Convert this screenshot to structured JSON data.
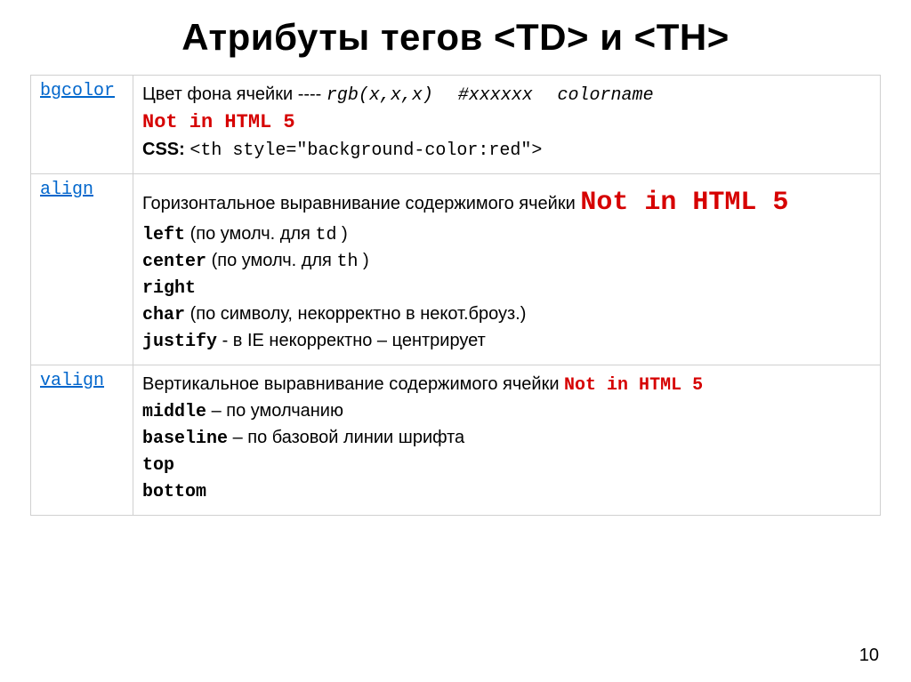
{
  "title": "Атрибуты тегов <TD> и <TH>",
  "pageNumber": "10",
  "rows": {
    "bgcolor": {
      "name": "bgcolor",
      "line1_a": "Цвет фона ячейки ---- ",
      "line1_rgb": "rgb(x,x,x)",
      "line1_hex": "#xxxxxx",
      "line1_cname": "colorname",
      "notIn": "Not in HTML 5",
      "cssLabel": "CSS:",
      "cssCode": "<th style=\"background-color:red\">"
    },
    "align": {
      "name": "align",
      "line1": "Горизонтальное выравнивание содержимого ячейки ",
      "notIn": "Not in HTML 5",
      "left_code": "left",
      "left_txt": " (по умолч. для ",
      "left_tag": "td",
      "left_close": ")",
      "center_code": "center",
      "center_txt": " (по умолч. для ",
      "center_tag": "th",
      "center_close": ")",
      "right_code": "right",
      "char_code": "char",
      "char_txt": " (по символу, некорректно в некот.броуз.)",
      "justify_code": "justify",
      "justify_txt": " - в IE некорректно – центрирует"
    },
    "valign": {
      "name": "valign",
      "line1": "Вертикальное выравнивание содержимого ячейки ",
      "notIn": "Not in HTML 5",
      "middle_code": "middle",
      "middle_txt": " – по умолчанию",
      "baseline_code": "baseline",
      "baseline_txt": " – по базовой линии шрифта",
      "top_code": "top",
      "bottom_code": "bottom"
    }
  }
}
